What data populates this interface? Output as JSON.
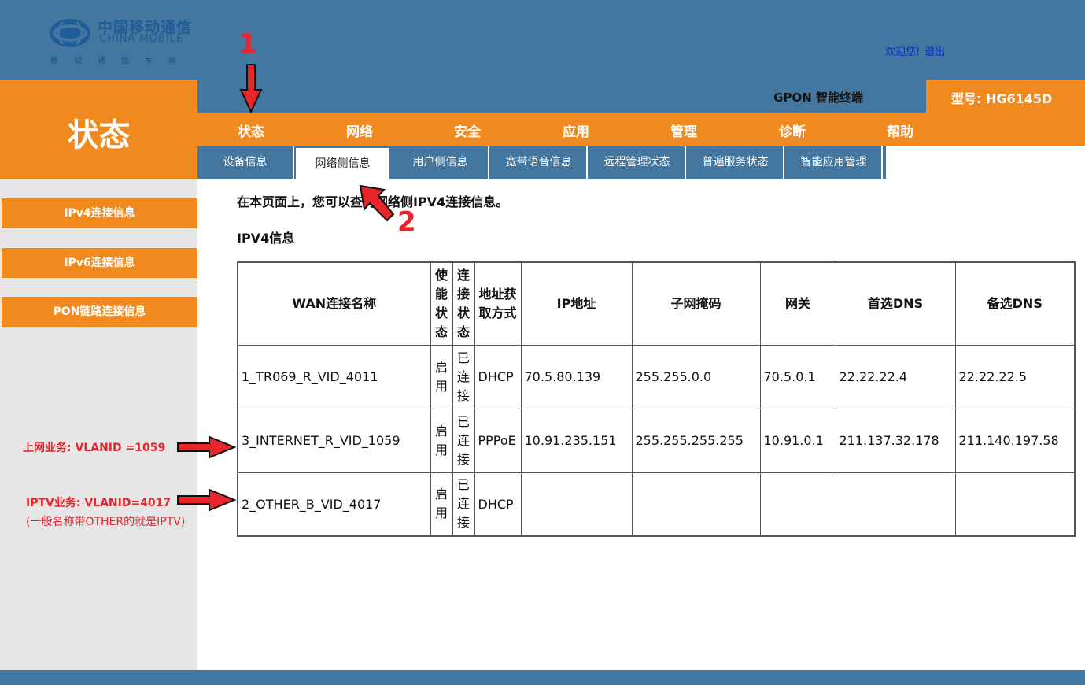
{
  "brand": {
    "name_cn": "中国移动通信",
    "name_en": "CHINA MOBILE",
    "slogan": "移动通信专家"
  },
  "header": {
    "welcome_text": "欢迎您!",
    "logout_label": "退出",
    "product_name": "GPON 智能终端",
    "model_label": "型号: HG6145D"
  },
  "section_title": "状态",
  "main_nav": [
    "状态",
    "网络",
    "安全",
    "应用",
    "管理",
    "诊断",
    "帮助"
  ],
  "sub_nav": [
    "设备信息",
    "网络侧信息",
    "用户侧信息",
    "宽带语音信息",
    "远程管理状态",
    "普遍服务状态",
    "智能应用管理"
  ],
  "sub_nav_active": "网络侧信息",
  "sidebar": [
    "IPv4连接信息",
    "IPv6连接信息",
    "PON链路连接信息"
  ],
  "main": {
    "description": "在本页面上，您可以查询网络侧IPV4连接信息。",
    "heading": "IPV4信息"
  },
  "table": {
    "headers": [
      "WAN连接名称",
      "使能状态",
      "连接状态",
      "地址获取方式",
      "IP地址",
      "子网掩码",
      "网关",
      "首选DNS",
      "备选DNS"
    ],
    "rows": [
      [
        "1_TR069_R_VID_4011",
        "启用",
        "已连接",
        "DHCP",
        "70.5.80.139",
        "255.255.0.0",
        "70.5.0.1",
        "22.22.22.4",
        "22.22.22.5"
      ],
      [
        "3_INTERNET_R_VID_1059",
        "启用",
        "已连接",
        "PPPoE",
        "10.91.235.151",
        "255.255.255.255",
        "10.91.0.1",
        "211.137.32.178",
        "211.140.197.58"
      ],
      [
        "2_OTHER_B_VID_4017",
        "启用",
        "已连接",
        "DHCP",
        "",
        "",
        "",
        "",
        ""
      ]
    ]
  },
  "annotations": {
    "step1": "1",
    "step2": "2",
    "internet_label": "上网业务: VLANID =1059",
    "iptv_label": "IPTV业务: VLANID=4017",
    "iptv_note": "(一般名称带OTHER的就是IPTV)"
  },
  "colors": {
    "header_blue": "#43779f",
    "accent_orange": "#f18a1e",
    "annotation_red": "#e8252b"
  }
}
